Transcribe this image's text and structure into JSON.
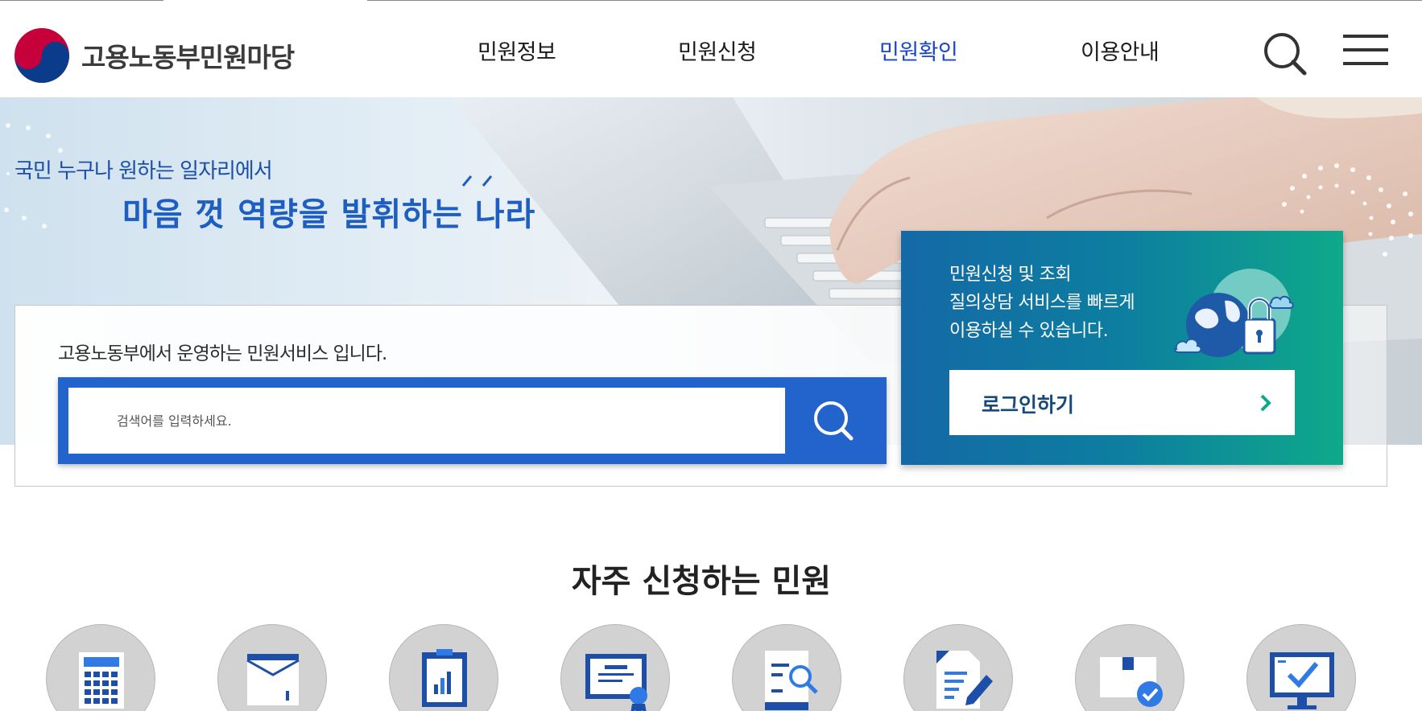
{
  "header": {
    "logo_text": "고용노동부민원마당",
    "nav": [
      {
        "label": "민원정보",
        "active": false
      },
      {
        "label": "민원신청",
        "active": false
      },
      {
        "label": "민원확인",
        "active": true
      },
      {
        "label": "이용안내",
        "active": false
      }
    ],
    "search_icon": "search-icon",
    "menu_icon": "hamburger-menu-icon"
  },
  "hero": {
    "subtitle": "국민 누구나 원하는 일자리에서",
    "title": "마음 껏 역량을 발휘하는 나라"
  },
  "search": {
    "description": "고용노동부에서 운영하는 민원서비스 입니다.",
    "placeholder": "검색어를 입력하세요.",
    "button_icon": "search-icon"
  },
  "login_panel": {
    "lines": [
      "민원신청 및 조회",
      "질의상담 서비스를 빠르게",
      "이용하실 수 있습니다."
    ],
    "button_label": "로그인하기",
    "illustration": "globe-lock-icon"
  },
  "frequent": {
    "title": "자주 신청하는 민원",
    "items": [
      {
        "icon": "calculator-icon"
      },
      {
        "icon": "envelope-icon"
      },
      {
        "icon": "bar-chart-document-icon"
      },
      {
        "icon": "certificate-icon"
      },
      {
        "icon": "document-search-icon"
      },
      {
        "icon": "document-edit-icon"
      },
      {
        "icon": "package-check-icon"
      },
      {
        "icon": "monitor-check-icon"
      }
    ]
  },
  "colors": {
    "primary_blue": "#2263cc",
    "nav_active": "#1b47c4",
    "panel_start": "#1469a6",
    "panel_end": "#0ea98a"
  }
}
